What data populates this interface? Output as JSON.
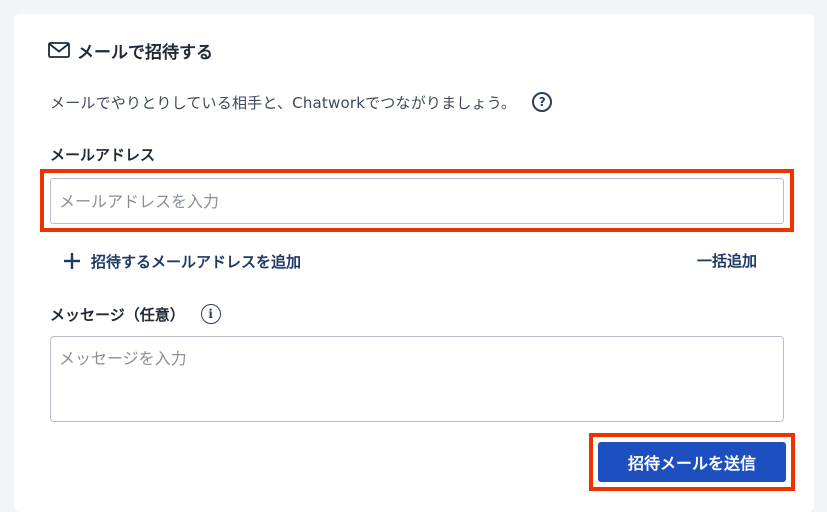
{
  "header": {
    "icon": "mail-icon",
    "title": "メールで招待する"
  },
  "description": {
    "text": "メールでやりとりしている相手と、Chatworkでつながりましょう。",
    "help_icon": "question-circle-icon",
    "help_glyph": "?"
  },
  "email": {
    "label": "メールアドレス",
    "value": "",
    "placeholder": "メールアドレスを入力"
  },
  "actions": {
    "add_email_icon": "plus-icon",
    "add_email_label": "招待するメールアドレスを追加",
    "bulk_add_label": "一括追加"
  },
  "message": {
    "label": "メッセージ（任意）",
    "info_icon": "info-circle-icon",
    "info_glyph": "i",
    "value": "",
    "placeholder": "メッセージを入力"
  },
  "submit": {
    "label": "招待メールを送信"
  },
  "colors": {
    "primary_button": "#1d4fbe",
    "highlight_border": "#ee3300",
    "link_text": "#1f3a66"
  }
}
